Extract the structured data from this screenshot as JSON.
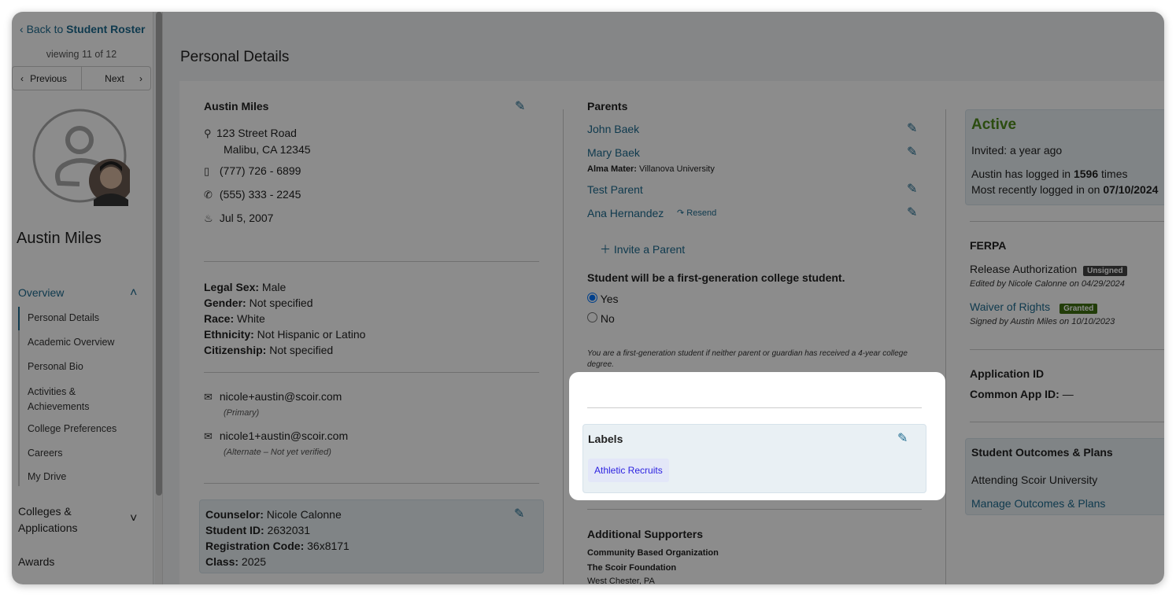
{
  "sidebar": {
    "back_prefix": "Back to",
    "back_target": "Student Roster",
    "viewing": "viewing 11 of 12",
    "previous": "Previous",
    "next": "Next",
    "student_name": "Austin Miles",
    "overview": "Overview",
    "items": [
      "Personal Details",
      "Academic Overview",
      "Personal Bio",
      "Activities &",
      "Achievements",
      "College Preferences",
      "Careers",
      "My Drive"
    ],
    "colleges_1": "Colleges &",
    "colleges_2": "Applications",
    "awards": "Awards"
  },
  "page_title": "Personal Details",
  "contact": {
    "name": "Austin Miles",
    "address1": "123 Street Road",
    "address2": "Malibu, CA 12345",
    "mobile": "(777) 726 - 6899",
    "phone": "(555) 333 - 2245",
    "birthday": "Jul 5, 2007"
  },
  "demographics": [
    {
      "k": "Legal Sex:",
      "v": "Male"
    },
    {
      "k": "Gender:",
      "v": "Not specified"
    },
    {
      "k": "Race:",
      "v": "White"
    },
    {
      "k": "Ethnicity:",
      "v": "Not Hispanic or Latino"
    },
    {
      "k": "Citizenship:",
      "v": "Not specified"
    }
  ],
  "emails": [
    {
      "address": "nicole+austin@scoir.com",
      "note": "(Primary)"
    },
    {
      "address": "nicole1+austin@scoir.com",
      "note": "(Alternate – Not yet verified)"
    }
  ],
  "school": [
    {
      "k": "Counselor:",
      "v": "Nicole Calonne"
    },
    {
      "k": "Student ID:",
      "v": "2632031"
    },
    {
      "k": "Registration Code:",
      "v": "36x8171"
    },
    {
      "k": "Class:",
      "v": "2025"
    }
  ],
  "parents": {
    "title": "Parents",
    "list": [
      "John Baek",
      "Mary Baek",
      "Test Parent",
      "Ana Hernandez"
    ],
    "alma_label": "Alma Mater:",
    "alma_value": "Villanova University",
    "resend": "Resend",
    "invite": "Invite a Parent"
  },
  "firstgen": {
    "question": "Student will be a first-generation college student.",
    "yes": "Yes",
    "no": "No",
    "selected": "Yes",
    "note": "You are a first-generation student if neither parent or guardian has received a 4-year college degree."
  },
  "labels": {
    "title": "Labels",
    "tags": [
      "Athletic Recruits"
    ]
  },
  "supporters": {
    "title": "Additional Supporters",
    "type": "Community Based Organization",
    "org": "The Scoir Foundation",
    "location": "West Chester, PA"
  },
  "status": {
    "state": "Active",
    "invited": "Invited: a year ago",
    "login_pre": "Austin has logged in",
    "login_count": "1596",
    "login_post": "times",
    "recent_pre": "Most recently logged in on",
    "recent_date": "07/10/2024"
  },
  "ferpa": {
    "title": "FERPA",
    "release": "Release Authorization",
    "release_badge": "Unsigned",
    "release_note": "Edited by Nicole Calonne on 04/29/2024",
    "waiver": "Waiver of Rights",
    "waiver_badge": "Granted",
    "waiver_note": "Signed by Austin Miles on 10/10/2023"
  },
  "appid": {
    "title": "Application ID",
    "label": "Common App ID:",
    "value": "—"
  },
  "outcomes": {
    "title": "Student Outcomes & Plans",
    "attending": "Attending Scoir University",
    "manage": "Manage Outcomes & Plans"
  },
  "colors": {
    "link": "#1d6a8f",
    "active": "#4f8a1c",
    "unsigned": "#444444",
    "granted": "#3f6f12",
    "tag_text": "#2a1fe0",
    "tag_bg": "#e3e7f8"
  }
}
